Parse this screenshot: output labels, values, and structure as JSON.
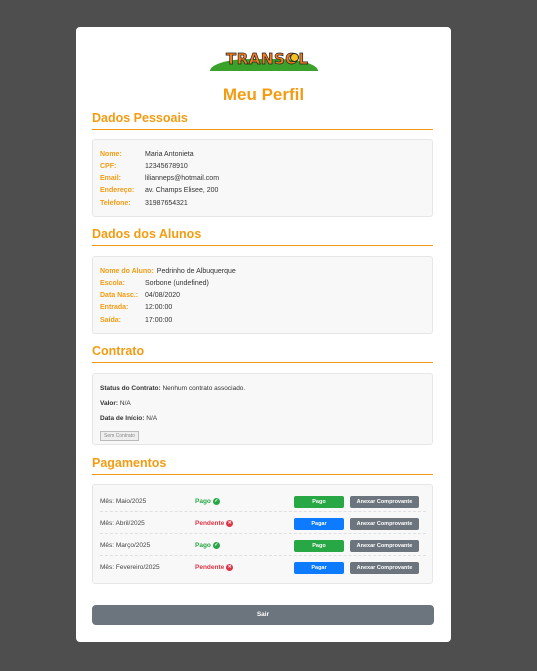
{
  "header": {
    "logo_text": "TRANSOL",
    "title": "Meu Perfil"
  },
  "dados_pessoais": {
    "heading": "Dados Pessoais",
    "fields": [
      {
        "label": "Nome:",
        "value": "Maria Antonieta"
      },
      {
        "label": "CPF:",
        "value": "12345678910"
      },
      {
        "label": "Email:",
        "value": "lilianneps@hotmail.com"
      },
      {
        "label": "Endereço:",
        "value": "av. Champs Elisee, 200"
      },
      {
        "label": "Telefone:",
        "value": "31987654321"
      }
    ]
  },
  "dados_alunos": {
    "heading": "Dados dos Alunos",
    "fields": [
      {
        "label": "Nome do Aluno:",
        "value": "Pedrinho de Albuquerque"
      },
      {
        "label": "Escola:",
        "value": "Sorbone (undefined)"
      },
      {
        "label": "Data Nasc.:",
        "value": "04/08/2020"
      },
      {
        "label": "Entrada:",
        "value": "12:00:00"
      },
      {
        "label": "Saída:",
        "value": "17:00:00"
      }
    ]
  },
  "contrato": {
    "heading": "Contrato",
    "status_label": "Status do Contrato:",
    "status_value": "Nenhum contrato associado.",
    "valor_label": "Valor:",
    "valor_value": "N/A",
    "inicio_label": "Data de Início:",
    "inicio_value": "N/A",
    "button_label": "Sem Contrato"
  },
  "pagamentos": {
    "heading": "Pagamentos",
    "rows": [
      {
        "mes": "Mês: Maio/2025",
        "status": "Pago",
        "action": "Pago",
        "anexar": "Anexar Comprovante"
      },
      {
        "mes": "Mês: Abril/2025",
        "status": "Pendente",
        "action": "Pagar",
        "anexar": "Anexar Comprovante"
      },
      {
        "mes": "Mês: Março/2025",
        "status": "Pago",
        "action": "Pago",
        "anexar": "Anexar Comprovante"
      },
      {
        "mes": "Mês: Fevereiro/2025",
        "status": "Pendente",
        "action": "Pagar",
        "anexar": "Anexar Comprovante"
      }
    ]
  },
  "footer": {
    "sair_label": "Sair"
  },
  "colors": {
    "accent": "#f39c12",
    "success": "#28a745",
    "danger": "#dc3545",
    "primary": "#0d7bff",
    "secondary": "#6c757d",
    "backdrop": "#4e4e4e"
  },
  "icons": {
    "pago": "check-circle-icon",
    "pendente": "x-circle-icon"
  }
}
